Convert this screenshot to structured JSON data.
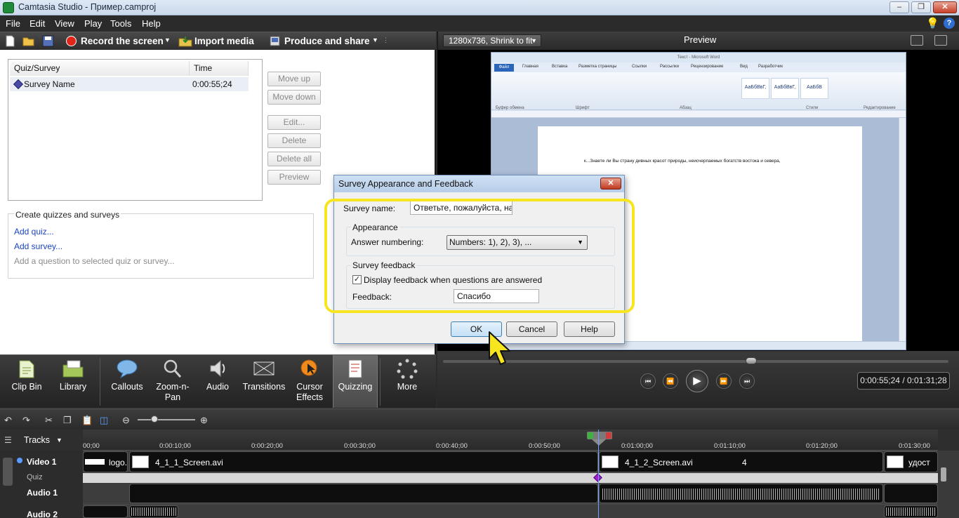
{
  "window": {
    "title": "Camtasia Studio - Пример.camproj",
    "controls": [
      "–",
      "❐",
      "✕"
    ]
  },
  "menu": {
    "items": [
      "File",
      "Edit",
      "View",
      "Play",
      "Tools",
      "Help"
    ],
    "help_icon": "?"
  },
  "toolbar": {
    "record_label": "Record the screen",
    "import_label": "Import media",
    "produce_label": "Produce and share"
  },
  "quiz_list": {
    "col_quiz": "Quiz/Survey",
    "col_time": "Time",
    "rows": [
      {
        "name": "Survey Name",
        "time": "0:00:55;24"
      }
    ]
  },
  "side_buttons": {
    "move_up": "Move up",
    "move_down": "Move down",
    "edit": "Edit...",
    "delete": "Delete",
    "delete_all": "Delete all",
    "preview": "Preview"
  },
  "create_box": {
    "title": "Create quizzes and surveys",
    "add_quiz": "Add quiz...",
    "add_survey": "Add survey...",
    "hint": "Add a question to selected quiz or survey..."
  },
  "preview": {
    "size_select": "1280x736, Shrink to fit",
    "title": "Preview",
    "timecode": "0:00:55;24 / 0:01:31;28",
    "scrub_fraction": 0.61
  },
  "word_preview": {
    "title": "Текст - Microsoft Word",
    "file_tab": "Файл",
    "tabs": [
      "Главная",
      "Вставка",
      "Разметка страницы",
      "Ссылки",
      "Рассылки",
      "Рецензирование",
      "Вид",
      "Разработчик"
    ],
    "groups": [
      "Буфер обмена",
      "Шрифт",
      "Абзац",
      "Стили",
      "Редактирование"
    ],
    "styles": [
      "АаБбВвГ,",
      "АаБбВвГ,",
      "АаБбВ"
    ],
    "doc_text": "к...Знаете ли Вы страну дивных красот природы, неисчерпаемых богатств востока и севера,"
  },
  "tasks": {
    "items": [
      {
        "label": "Clip Bin"
      },
      {
        "label": "Library"
      },
      {
        "label": "Callouts"
      },
      {
        "label": "Zoom-n-\nPan"
      },
      {
        "label": "Audio"
      },
      {
        "label": "Transitions"
      },
      {
        "label": "Cursor\nEffects"
      },
      {
        "label": "Quizzing"
      },
      {
        "label": "More"
      }
    ],
    "active": "Quizzing"
  },
  "timeline": {
    "tracks_label": "Tracks",
    "ruler": [
      "00;00",
      "0:00:10;00",
      "0:00:20;00",
      "0:00:30;00",
      "0:00:40;00",
      "0:00:50;00",
      "0:01:00;00",
      "0:01:10;00",
      "0:01:20;00",
      "0:01:30;00"
    ],
    "track_names": {
      "video": "Video 1",
      "quiz": "Quiz",
      "audio1": "Audio 1",
      "audio2": "Audio 2"
    },
    "clips": {
      "logo": "logo.",
      "clip1": "4_1_1_Screen.avi",
      "clip2": "4_1_2_Screen.avi",
      "clip2_marker": "4",
      "clip3": "удост"
    }
  },
  "dialog": {
    "title": "Survey Appearance and Feedback",
    "survey_name_label": "Survey name:",
    "survey_name_value": "Ответьте, пожалуйста, на",
    "appearance_group": "Appearance",
    "answer_numbering_label": "Answer numbering:",
    "answer_numbering_value": "Numbers: 1), 2), 3), ...",
    "feedback_group": "Survey feedback",
    "display_feedback_label": "Display feedback when questions are answered",
    "display_feedback_checked": true,
    "feedback_label": "Feedback:",
    "feedback_value": "Спасибо",
    "ok": "OK",
    "cancel": "Cancel",
    "help": "Help"
  },
  "colors": {
    "highlight": "#f6e51f",
    "link": "#1a44c4",
    "record_red": "#e0261b"
  }
}
